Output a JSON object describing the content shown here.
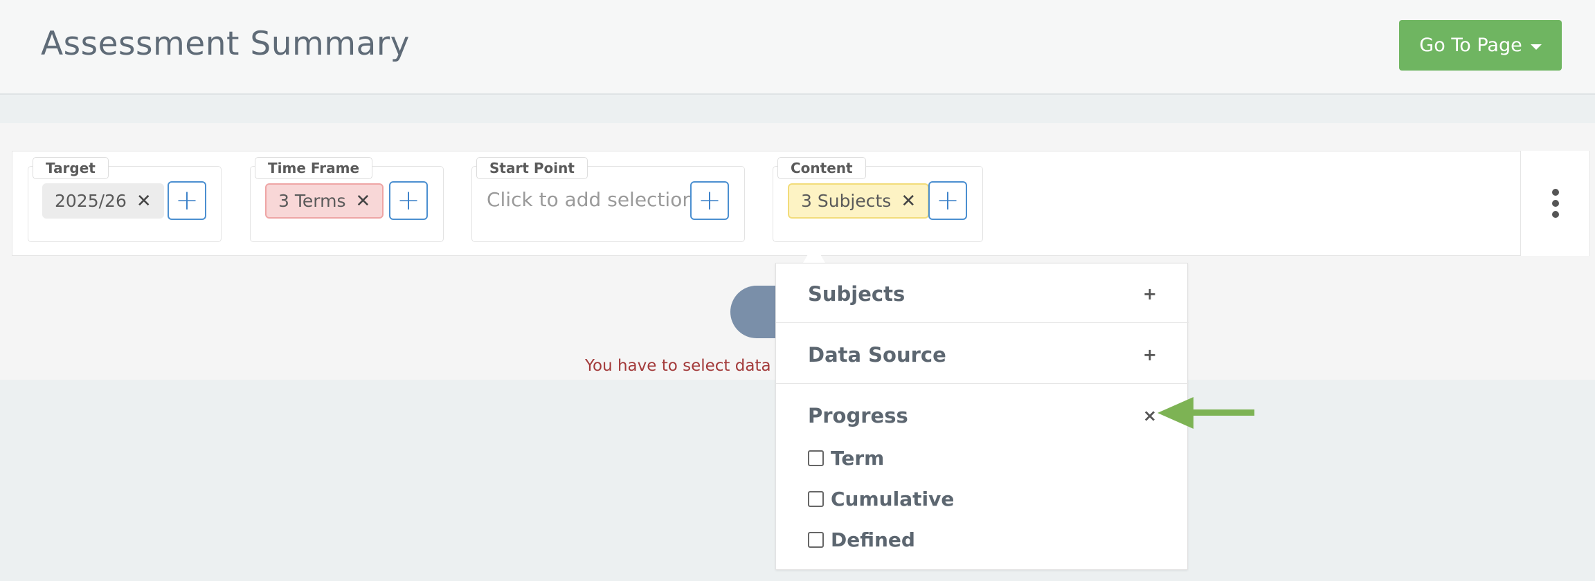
{
  "header": {
    "title": "Assessment Summary",
    "goto_label": "Go To Page"
  },
  "filters": {
    "target": {
      "label": "Target",
      "tag": "2025/26"
    },
    "time_frame": {
      "label": "Time Frame",
      "tag": "3 Terms"
    },
    "start_point": {
      "label": "Start Point",
      "placeholder": "Click to add selection"
    },
    "content": {
      "label": "Content",
      "tag": "3 Subjects"
    },
    "remove_glyph": "✕",
    "add_glyph": "+"
  },
  "error": {
    "text": "You have to select data s"
  },
  "dropdown": {
    "subjects": {
      "label": "Subjects",
      "sign": "+"
    },
    "data_source": {
      "label": "Data Source",
      "sign": "+"
    },
    "progress": {
      "label": "Progress",
      "sign": "×"
    },
    "options": [
      "Term",
      "Cumulative",
      "Defined"
    ]
  },
  "colors": {
    "accent_green": "#6fb561",
    "add_blue": "#4b8fd0",
    "annotation_arrow": "#7db354",
    "error_red": "#a33a3a"
  }
}
